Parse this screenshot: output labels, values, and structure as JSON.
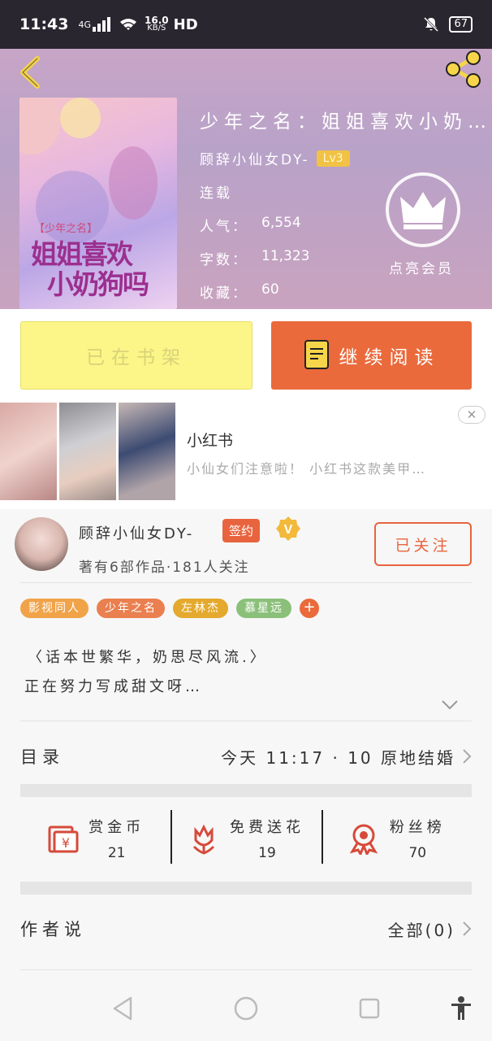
{
  "status_bar": {
    "time": "11:43",
    "network": "4G",
    "speed_value": "16.0",
    "speed_unit": "KB/S",
    "hd": "HD",
    "battery": "67"
  },
  "book": {
    "title": "少年之名：姐姐喜欢小奶狗吗",
    "author": "顾辞小仙女DY-",
    "level": "Lv3",
    "status": "连载",
    "popularity_label": "人气：",
    "popularity": "6,554",
    "words_label": "字数：",
    "words": "11,323",
    "favorites_label": "收藏：",
    "favorites": "60",
    "cover_small": "【少年之名】",
    "cover_line1": "姐姐喜欢",
    "cover_line2": "小奶狗吗",
    "vip_label": "点亮会员"
  },
  "buttons": {
    "shelf": "已在书架",
    "read": "继续阅读"
  },
  "ad": {
    "title": "小红书",
    "desc": "小仙女们注意啦！ 小红书这款美甲…",
    "close": "✕"
  },
  "author_profile": {
    "name": "顾辞小仙女DY-",
    "sign": "签约",
    "summary": "著有6部作品·181人关注",
    "follow": "已关注"
  },
  "tags": [
    {
      "label": "影视同人",
      "color": "#f0a348"
    },
    {
      "label": "少年之名",
      "color": "#ea7f4f"
    },
    {
      "label": "左林杰",
      "color": "#e4a92d"
    },
    {
      "label": "慕星远",
      "color": "#8bc07a"
    }
  ],
  "bio": {
    "line1": "〈话本世繁华，奶思尽风流.〉",
    "line2": "正在努力写成甜文呀…"
  },
  "catalog": {
    "label": "目录",
    "latest": "今天 11:17 · 10 原地结婚"
  },
  "rewards": [
    {
      "label": "赏金币",
      "count": "21",
      "icon": "coin-envelope-icon"
    },
    {
      "label": "免费送花",
      "count": "19",
      "icon": "flower-icon"
    },
    {
      "label": "粉丝榜",
      "count": "70",
      "icon": "medal-icon"
    }
  ],
  "author_says": {
    "label": "作者说",
    "all": "全部(0)"
  },
  "colors": {
    "accent": "#ea6a3c",
    "shelf": "#fbf687"
  }
}
